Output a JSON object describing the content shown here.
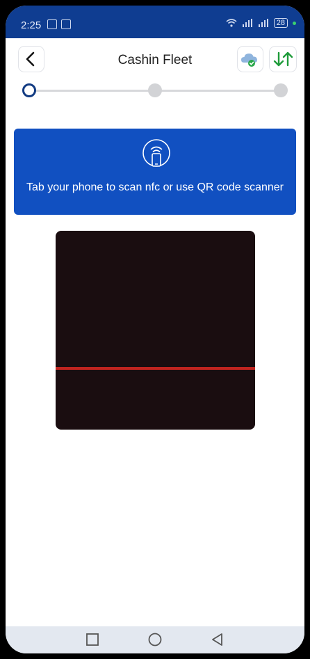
{
  "status_bar": {
    "time": "2:25",
    "battery": "28"
  },
  "header": {
    "title": "Cashin Fleet",
    "icons": [
      "back-arrow-icon",
      "cloud-sync-icon",
      "sort-arrows-icon"
    ]
  },
  "stepper": {
    "current_step": 1,
    "total_steps": 3
  },
  "banner": {
    "icon": "nfc-phone-icon",
    "text": "Tab your phone to scan nfc or use QR code scanner"
  },
  "scanner": {
    "state": "scanning"
  },
  "nav": {
    "icons": [
      "recent-apps-icon",
      "home-icon",
      "back-icon"
    ]
  },
  "colors": {
    "status_bar": "#0f3d91",
    "banner": "#1150c1",
    "scan_line": "#c0241f",
    "step_active": "#123b82",
    "sync_arrows": "#1e9b3a"
  }
}
